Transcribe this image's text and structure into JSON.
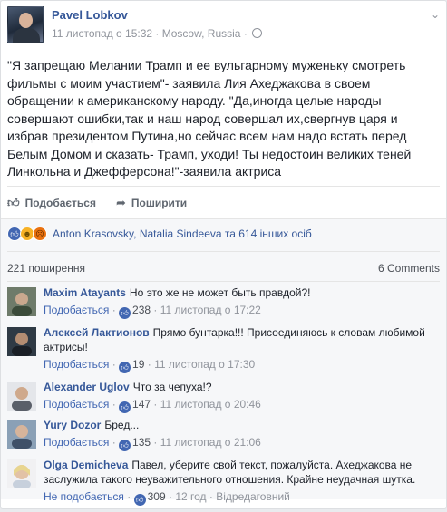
{
  "post": {
    "author": "Pavel Lobkov",
    "timestamp": "11 листопад о 15:32",
    "location": "Moscow, Russia",
    "separator": "·",
    "privacy_icon": "globe-icon",
    "menu_icon": "chevron-down-icon",
    "text": "\"Я запрещаю Мелании Трамп и ее вульгарному муженьку смотреть фильмы с моим участием\"- заявила Лия Ахеджакова в своем обращении к американскому народу. \"Да,иногда целые народы совершают ошибки,так и наш народ совершал их,свергнув царя и избрав президентом Путина,но сейчас всем нам надо встать перед Белым Домом и сказать- Трамп, уходи! Ты недостоин великих теней Линкольна и Джефферсона!\"-заявила актриса"
  },
  "actions": {
    "like_label": "Подобається",
    "share_label": "Поширити"
  },
  "reactions": {
    "icons": [
      "like-icon",
      "haha-icon",
      "angry-icon"
    ],
    "summary": "Anton Krasovsky, Natalia Sindeeva та 614 інших осіб"
  },
  "stats": {
    "shares": "221 поширення",
    "comments": "6 Comments"
  },
  "colors": {
    "link": "#365899",
    "accent": "#4267b2",
    "meta": "#90949c"
  },
  "comments": [
    {
      "author": "Maxim Atayants",
      "text": "Но это же не может быть правдой?!",
      "like_label": "Подобається",
      "likes": "238",
      "time": "11 листопад о 17:22",
      "dot": "·"
    },
    {
      "author": "Алексей Лактионов",
      "text": "Прямо бунтарка!!! Присоединяюсь к словам любимой актрисы!",
      "like_label": "Подобається",
      "likes": "19",
      "time": "11 листопад о 17:30",
      "dot": "·"
    },
    {
      "author": "Alexander Uglov",
      "text": "Что за чепуха!?",
      "like_label": "Подобається",
      "likes": "147",
      "time": "11 листопад о 20:46",
      "dot": "·"
    },
    {
      "author": "Yury Dozor",
      "text": "Бред...",
      "like_label": "Подобається",
      "likes": "135",
      "time": "11 листопад о 21:06",
      "dot": "·"
    },
    {
      "author": "Olga Demicheva",
      "text": "Павел, уберите свой текст, пожалуйста. Ахеджакова не заслужила такого неуважительного отношения. Крайне неудачная шутка.",
      "like_label": "Не подобається",
      "likes": "309",
      "time": "12 год",
      "edited": "Відредаговний",
      "dot": "·"
    }
  ]
}
